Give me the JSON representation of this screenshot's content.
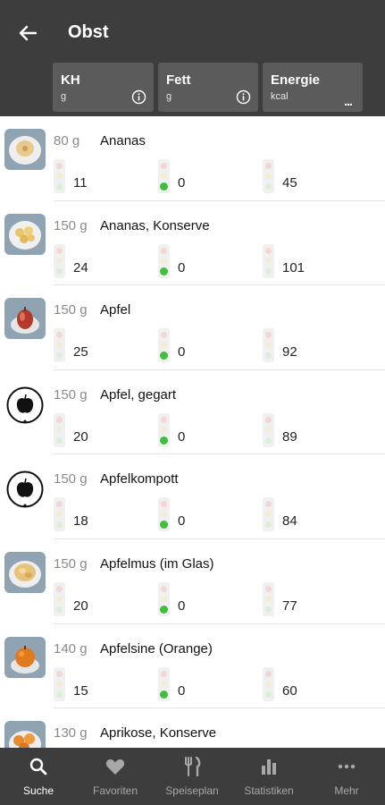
{
  "header": {
    "title": "Obst",
    "columns": [
      {
        "name": "KH",
        "unit": "g",
        "icon": "info-icon"
      },
      {
        "name": "Fett",
        "unit": "g",
        "icon": "info-icon"
      },
      {
        "name": "Energie",
        "unit": "kcal",
        "icon": "more-horizontal-icon",
        "icon_text": "..."
      }
    ]
  },
  "items": [
    {
      "amount": "80 g",
      "name": "Ananas",
      "kh": "11",
      "fett": "0",
      "energie": "45",
      "image": "pineapple-photo"
    },
    {
      "amount": "150 g",
      "name": "Ananas, Konserve",
      "kh": "24",
      "fett": "0",
      "energie": "101",
      "image": "canned-pineapple-photo"
    },
    {
      "amount": "150 g",
      "name": "Apfel",
      "kh": "25",
      "fett": "0",
      "energie": "92",
      "image": "apple-photo"
    },
    {
      "amount": "150 g",
      "name": "Apfel, gegart",
      "kh": "20",
      "fett": "0",
      "energie": "89",
      "image": "apple-icon"
    },
    {
      "amount": "150 g",
      "name": "Apfelkompott",
      "kh": "18",
      "fett": "0",
      "energie": "84",
      "image": "apple-icon"
    },
    {
      "amount": "150 g",
      "name": "Apfelmus (im Glas)",
      "kh": "20",
      "fett": "0",
      "energie": "77",
      "image": "applesauce-photo"
    },
    {
      "amount": "140 g",
      "name": "Apfelsine (Orange)",
      "kh": "15",
      "fett": "0",
      "energie": "60",
      "image": "orange-photo"
    },
    {
      "amount": "130 g",
      "name": "Aprikose, Konserve",
      "kh": "",
      "fett": "",
      "energie": "",
      "image": "canned-apricot-photo"
    }
  ],
  "nav": [
    {
      "label": "Suche",
      "icon": "search-icon",
      "active": true
    },
    {
      "label": "Favoriten",
      "icon": "heart-icon",
      "active": false
    },
    {
      "label": "Speiseplan",
      "icon": "fork-knife-icon",
      "active": false
    },
    {
      "label": "Statistiken",
      "icon": "bar-chart-icon",
      "active": false
    },
    {
      "label": "Mehr",
      "icon": "more-horizontal-icon",
      "active": false
    }
  ],
  "colors": {
    "bar_bg": "#3d3d3d",
    "header_cell": "#5b5b5b",
    "green_dot": "#3fbf3b",
    "nav_active": "#ffffff",
    "nav_inactive": "#a8a8a8"
  }
}
